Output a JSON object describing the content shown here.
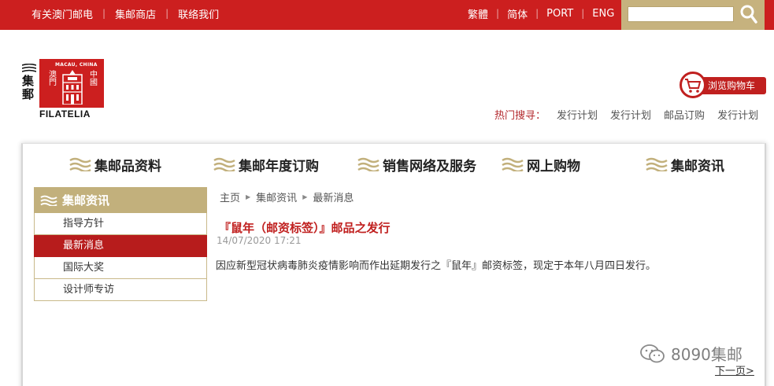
{
  "topbar": {
    "left_links": [
      "有关澳门邮电",
      "集邮商店",
      "联络我们"
    ],
    "right_links": [
      "繁體",
      "简体",
      "PORT",
      "ENG"
    ],
    "search_placeholder": ""
  },
  "logo": {
    "brand_vertical": "集\n郵",
    "macau_text": "MACAU, CHINA",
    "stamp_left": "澳\n門",
    "stamp_right": "中\n國",
    "wordmark": "FILATELIA"
  },
  "header": {
    "cart_label": "浏览购物车",
    "hot_search_label": "热门搜寻：",
    "hot_search_links": [
      "发行计划",
      "发行计划",
      "邮品订购",
      "发行计划"
    ]
  },
  "mainnav": [
    "集邮品资料",
    "集邮年度订购",
    "销售网络及服务",
    "网上购物",
    "集邮资讯"
  ],
  "sidebar": {
    "title": "集邮资讯",
    "items": [
      "指导方针",
      "最新消息",
      "国际大奖",
      "设计师专访"
    ],
    "active_index": 1
  },
  "breadcrumb": [
    "主页",
    "集邮资讯",
    "最新消息"
  ],
  "article": {
    "title": "『鼠年（邮资标签）』邮品之发行",
    "date": "14/07/2020 17:21",
    "body": "因应新型冠状病毒肺炎疫情影响而作出延期发行之『鼠年』邮资标签，现定于本年八月四日发行。"
  },
  "watermark": "8090集邮",
  "pagination": {
    "next_label": "下一页>"
  },
  "colors": {
    "brand_red": "#cc1f1f",
    "gold": "#c2b07c",
    "active_red": "#b71c1c"
  }
}
